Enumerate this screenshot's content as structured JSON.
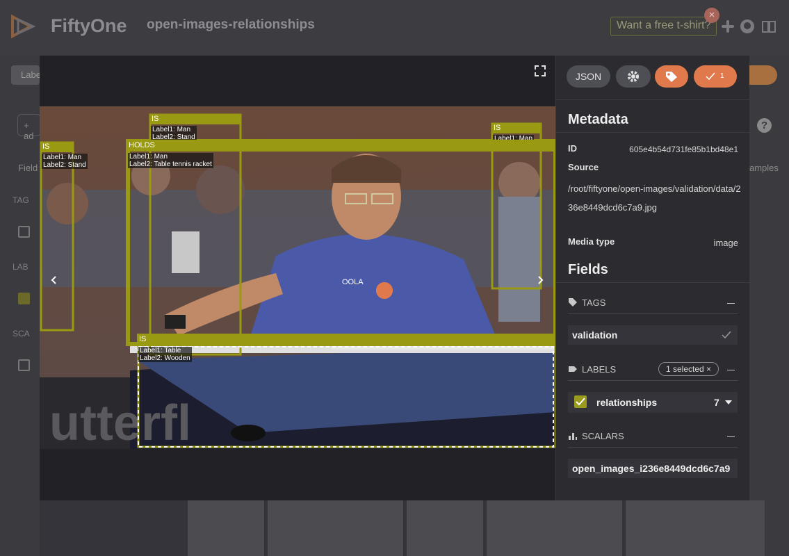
{
  "header": {
    "app_name": "FiftyOne",
    "dataset_name": "open-images-relationships",
    "tshirt_label": "Want a free t-shirt?",
    "tshirt_close": "×"
  },
  "background": {
    "labels_chip": "Labe",
    "add_button": "+ ad",
    "fields_label": "Field",
    "tags_section": "TAG",
    "labels_section": "LAB",
    "scalars_section": "SCA",
    "samples_label": "amples",
    "help": "?"
  },
  "modal": {
    "buttons": {
      "json": "JSON",
      "check_count": "1"
    },
    "metadata": {
      "title": "Metadata",
      "id_key": "ID",
      "id_value": "605e4b54d731fe85b1bd48e1",
      "source_key": "Source",
      "source_value": "/root/fiftyone/open-images/validation/data/236e8449dcd6c7a9.jpg",
      "media_key": "Media type",
      "media_value": "image"
    },
    "fields": {
      "title": "Fields",
      "tags_header": "TAGS",
      "tag_value": "validation",
      "labels_header": "LABELS",
      "labels_selected": "1 selected ×",
      "relationships_label": "relationships",
      "relationships_count": "7",
      "scalars_header": "SCALARS",
      "scalar_value": "open_images_i236e8449dcd6c7a9"
    },
    "boxes": [
      {
        "name": "is-stand-left",
        "title": "IS",
        "l1": "Label1: Man",
        "l2": "Label2: Stand"
      },
      {
        "name": "is-stand-top",
        "title": "IS",
        "l1": "Label1: Man",
        "l2": "Label2: Stand"
      },
      {
        "name": "is-right",
        "title": "IS",
        "l1": "Label1: Man",
        "l2": ""
      },
      {
        "name": "holds",
        "title": "HOLDS",
        "l1": "Label1: Man",
        "l2": "Label2: Table tennis racket"
      },
      {
        "name": "is-table",
        "title": "IS",
        "l1": "Label1: Table",
        "l2": "Label2: Wooden"
      }
    ]
  },
  "colors": {
    "box": "#9a9a12",
    "accent": "#e07a4c"
  }
}
